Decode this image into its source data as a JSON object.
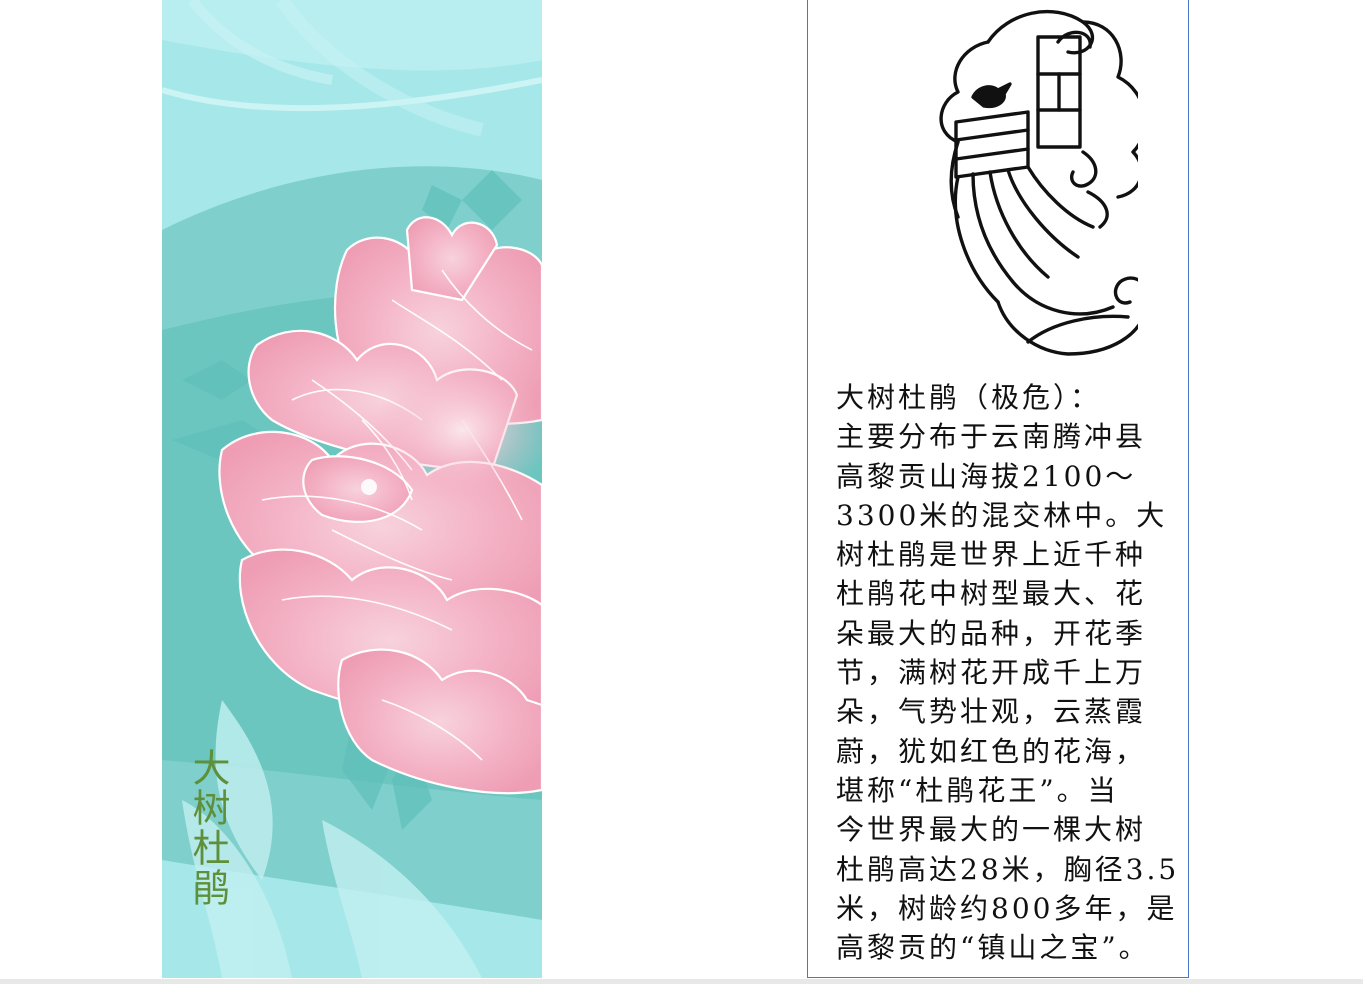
{
  "bookmark": {
    "vertical_title": "大树杜鹃",
    "colors": {
      "background": "#9fe3e3",
      "teal_shadow": "#6cc9c4",
      "petal_pink": "#f4b8c8",
      "petal_deep": "#ef95ae",
      "title_green": "#5e8f3a"
    }
  },
  "info": {
    "emblem_icon": "rhododendron-line-emblem",
    "description_lines": [
      "大树杜鹃（极危）：",
      "主要分布于云南腾冲县",
      "高黎贡山海拔2100～",
      "3300米的混交林中。大",
      "树杜鹃是世界上近千种",
      "杜鹃花中树型最大、花",
      "朵最大的品种，开花季",
      "节，满树花开成千上万",
      "朵，气势壮观，云蒸霞",
      "蔚，犹如红色的花海，",
      "堪称“杜鹃花王”。当",
      "今世界最大的一棵大树",
      "杜鹃高达28米，胸径3.5",
      "米，树龄约800多年，是",
      "高黎贡的“镇山之宝”。"
    ],
    "border_color": "#4a78c8"
  }
}
